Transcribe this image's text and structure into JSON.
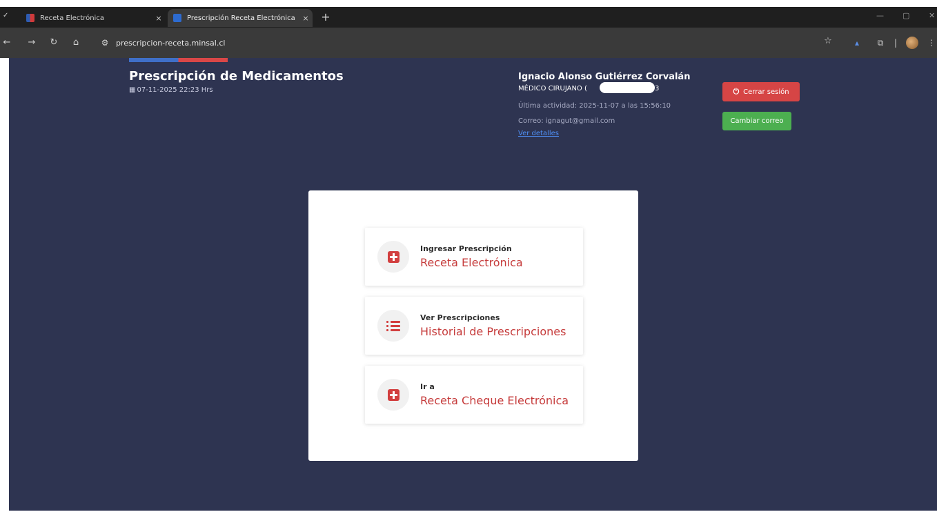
{
  "browser": {
    "tabs": [
      {
        "label": "Receta Electrónica",
        "close": "×"
      },
      {
        "label": "Prescripción Receta Electrónica",
        "close": "×"
      }
    ],
    "new_tab": "+",
    "url": "prescripcion-receta.minsal.cl"
  },
  "header": {
    "title": "Prescripción de Medicamentos",
    "date": "07-11-2025 22:23 Hrs"
  },
  "user": {
    "name": "Ignacio Alonso Gutiérrez Corvalán",
    "role": "MÉDICO CIRUJANO (",
    "role_suffix": "3",
    "last_activity": "Última actividad: 2025-11-07 a las 15:56:10",
    "email": "Correo: ignagut@gmail.com",
    "details_link": "Ver detalles"
  },
  "buttons": {
    "logout": "Cerrar sesión",
    "change_email": "Cambiar correo"
  },
  "options": [
    {
      "small": "Ingresar Prescripción",
      "big": "Receta Electrónica",
      "icon": "plus-square-icon"
    },
    {
      "small": "Ver Prescripciones",
      "big": "Historial de Prescripciones",
      "icon": "list-icon"
    },
    {
      "small": "Ir a",
      "big": "Receta Cheque Electrónica",
      "icon": "plus-square-icon"
    }
  ],
  "colors": {
    "page_bg": "#2e3451",
    "accent_red": "#c63c3c",
    "logout_red": "#d64545",
    "email_green": "#4caf50",
    "link_blue": "#4f8ff5"
  }
}
